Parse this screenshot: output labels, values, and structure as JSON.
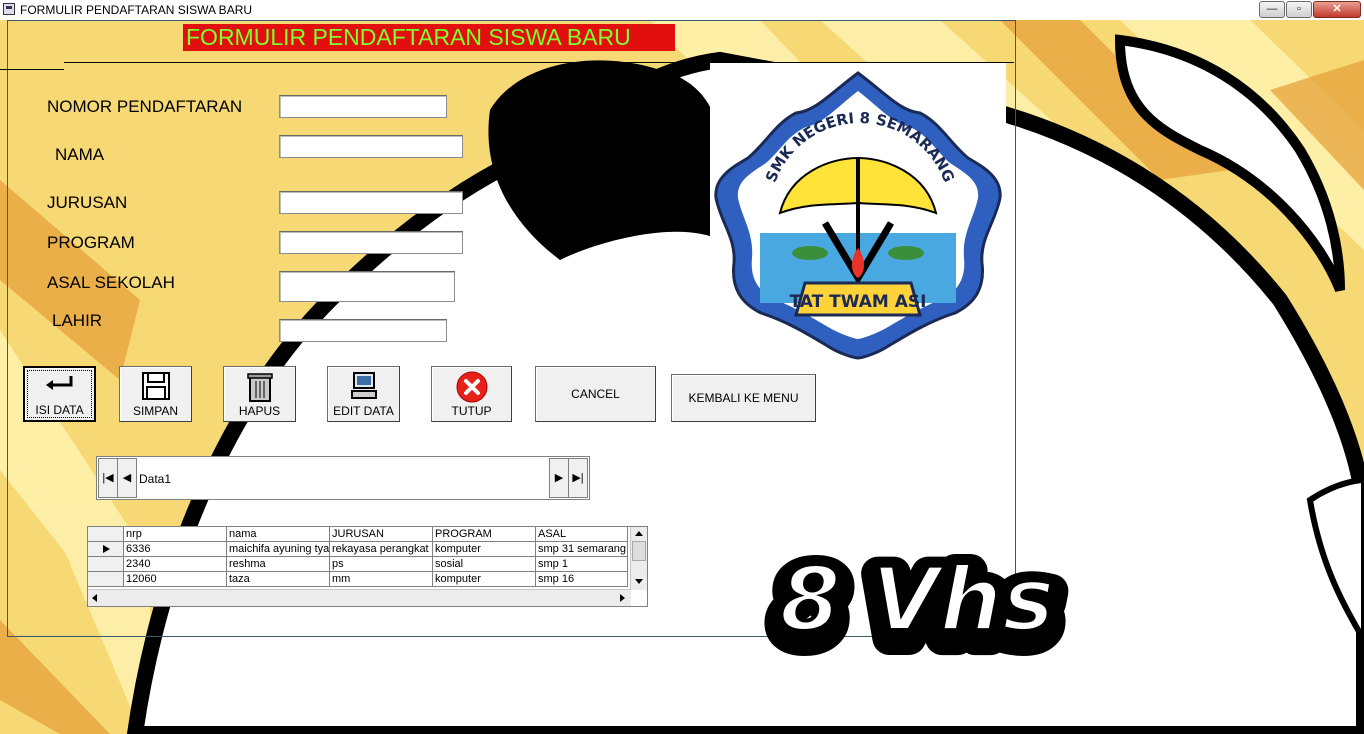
{
  "window": {
    "title": "FORMULIR PENDAFTARAN SISWA BARU",
    "buttons": {
      "minimize": "—",
      "maximize": "▫",
      "close": "✕"
    }
  },
  "form": {
    "heading": "FORMULIR PENDAFTARAN SISWA BARU",
    "fields": [
      {
        "label": "NOMOR PENDAFTARAN",
        "value": ""
      },
      {
        "label": "NAMA",
        "value": ""
      },
      {
        "label": "JURUSAN",
        "value": ""
      },
      {
        "label": "PROGRAM",
        "value": ""
      },
      {
        "label": "ASAL SEKOLAH",
        "value": ""
      },
      {
        "label": "LAHIR",
        "value": ""
      }
    ]
  },
  "logo": {
    "school_text": "SMK NEGERI 8 SEMARANG",
    "motto": "TAT TWAM ASI"
  },
  "buttons": {
    "isi_data": "ISI DATA",
    "simpan": "SIMPAN",
    "hapus": "HAPUS",
    "edit_data": "EDIT DATA",
    "tutup": "TUTUP",
    "cancel": "CANCEL",
    "kembali": "KEMBALI KE MENU"
  },
  "data_control": {
    "caption": "Data1",
    "nav": {
      "first": "|◀",
      "prev": "◀",
      "next": "▶",
      "last": "▶|"
    }
  },
  "grid": {
    "columns": [
      "nrp",
      "nama",
      "JURUSAN",
      "PROGRAM",
      "ASAL"
    ],
    "rows": [
      [
        "6336",
        "maichifa ayuning tyas",
        "rekayasa perangkat",
        "komputer",
        "smp 31 semarang"
      ],
      [
        "2340",
        "reshma",
        "ps",
        "sosial",
        "smp 1"
      ],
      [
        "12060",
        "taza",
        "mm",
        "komputer",
        "smp 16"
      ]
    ]
  },
  "watermark": "8 Vhs",
  "colors": {
    "title_bg": "#e20f0f",
    "title_fg": "#7bff2e",
    "background": "#f6d874"
  }
}
